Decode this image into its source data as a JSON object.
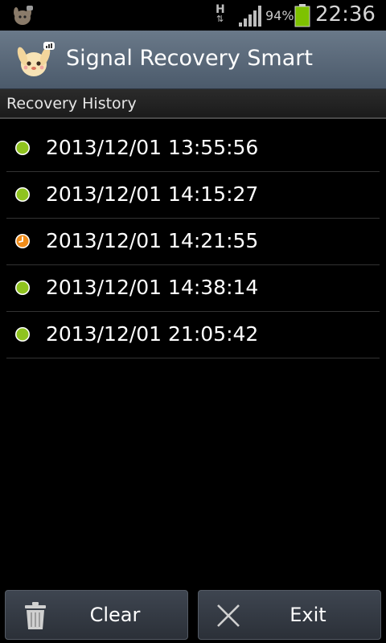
{
  "status_bar": {
    "network_type": "H",
    "network_arrows": "⇅",
    "battery_percent": "94%",
    "time": "22:36",
    "battery_color": "#7ec200"
  },
  "app": {
    "title": "Signal Recovery Smart"
  },
  "section": {
    "title": "Recovery History"
  },
  "history": [
    {
      "time": "2013/12/01 13:55:56",
      "status": "recovered",
      "status_color": "#8fc31f",
      "icon": "green-dot-icon"
    },
    {
      "time": "2013/12/01 14:15:27",
      "status": "recovered",
      "status_color": "#8fc31f",
      "icon": "green-dot-icon"
    },
    {
      "time": "2013/12/01 14:21:55",
      "status": "pending",
      "status_color": "#f08c1a",
      "icon": "orange-clock-icon"
    },
    {
      "time": "2013/12/01 14:38:14",
      "status": "recovered",
      "status_color": "#8fc31f",
      "icon": "green-dot-icon"
    },
    {
      "time": "2013/12/01 21:05:42",
      "status": "recovered",
      "status_color": "#8fc31f",
      "icon": "green-dot-icon"
    }
  ],
  "buttons": {
    "clear_label": "Clear",
    "clear_icon": "trash-icon",
    "exit_label": "Exit",
    "exit_icon": "close-icon"
  }
}
